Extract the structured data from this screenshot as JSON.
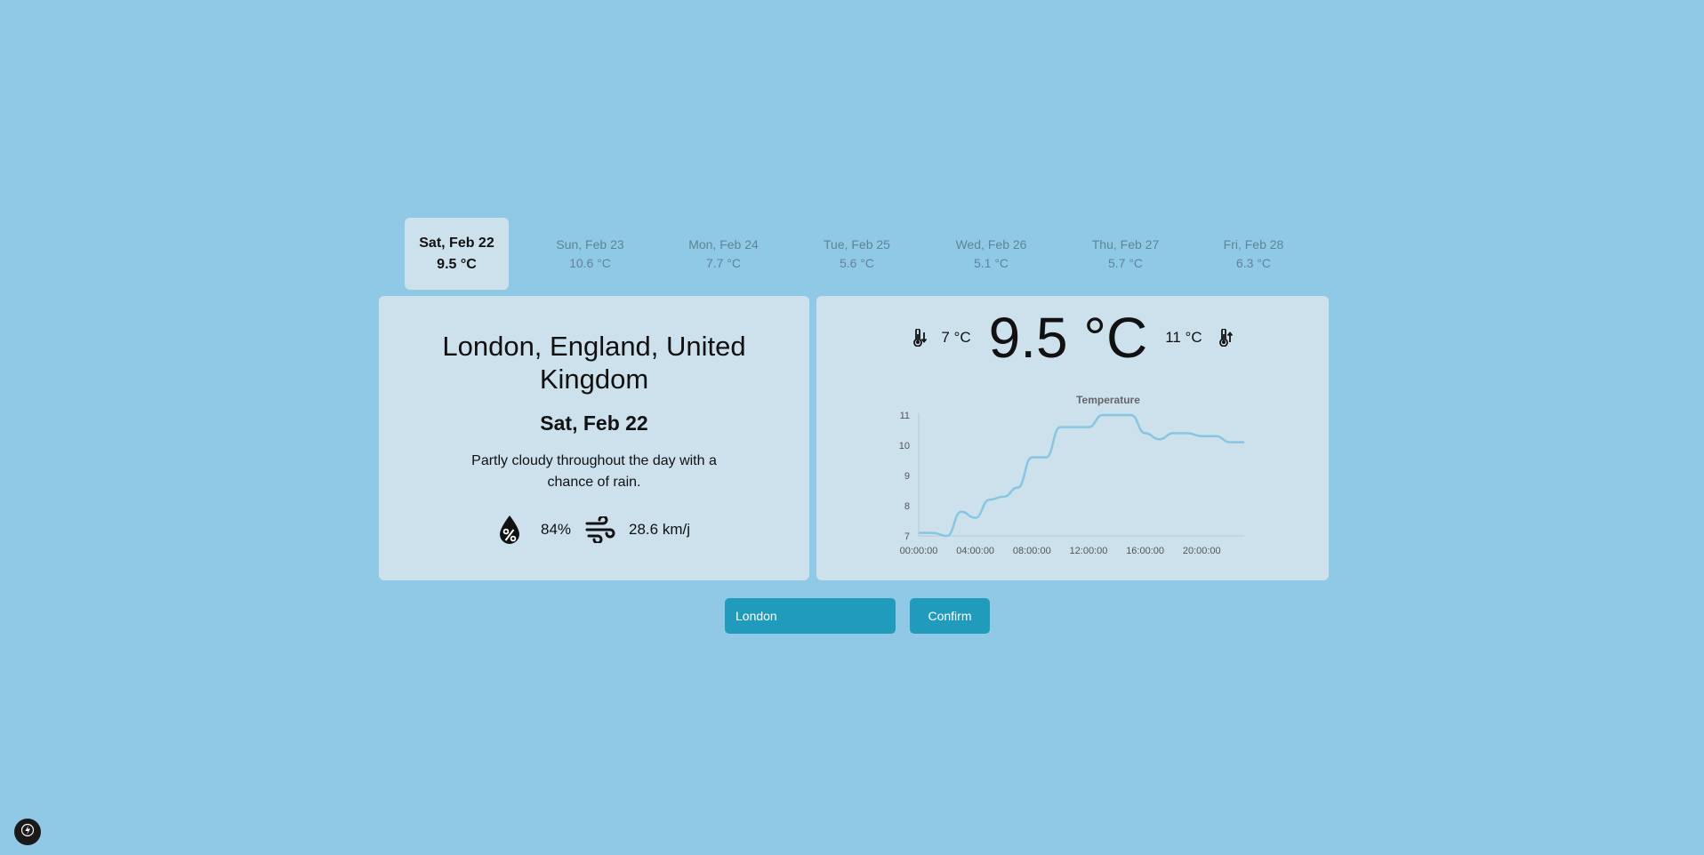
{
  "forecast": [
    {
      "date": "Sat, Feb 22",
      "temp": "9.5 °C"
    },
    {
      "date": "Sun, Feb 23",
      "temp": "10.6 °C"
    },
    {
      "date": "Mon, Feb 24",
      "temp": "7.7 °C"
    },
    {
      "date": "Tue, Feb 25",
      "temp": "5.6 °C"
    },
    {
      "date": "Wed, Feb 26",
      "temp": "5.1 °C"
    },
    {
      "date": "Thu, Feb 27",
      "temp": "5.7 °C"
    },
    {
      "date": "Fri, Feb 28",
      "temp": "6.3 °C"
    }
  ],
  "details": {
    "location": "London, England, United Kingdom",
    "date": "Sat, Feb 22",
    "description": "Partly cloudy throughout the day with a chance of rain.",
    "humidity": "84%",
    "wind": "28.6 km/j"
  },
  "current": {
    "min": "7 °C",
    "temp": "9.5 °C",
    "max": "11 °C"
  },
  "search": {
    "value": "London"
  },
  "confirm_label": "Confirm",
  "colors": {
    "background": "#90c9e6",
    "card": "#cde1ec",
    "accent": "#219bbc",
    "line": "#87c6e3"
  },
  "icons": {
    "humidity": "humidity-drop-icon",
    "wind": "wind-icon",
    "min": "thermometer-down-icon",
    "max": "thermometer-up-icon",
    "badge": "lightning-icon"
  },
  "chart_data": {
    "type": "line",
    "title": "Temperature",
    "xlabel": "",
    "ylabel": "",
    "x": [
      "00:00:00",
      "01:00:00",
      "02:00:00",
      "03:00:00",
      "04:00:00",
      "05:00:00",
      "06:00:00",
      "07:00:00",
      "08:00:00",
      "09:00:00",
      "10:00:00",
      "11:00:00",
      "12:00:00",
      "13:00:00",
      "14:00:00",
      "15:00:00",
      "16:00:00",
      "17:00:00",
      "18:00:00",
      "19:00:00",
      "20:00:00",
      "21:00:00",
      "22:00:00",
      "23:00:00"
    ],
    "xticks": [
      "00:00:00",
      "04:00:00",
      "08:00:00",
      "12:00:00",
      "16:00:00",
      "20:00:00"
    ],
    "yticks": [
      7,
      8,
      9,
      10,
      11
    ],
    "ylim": [
      7,
      11
    ],
    "series": [
      {
        "values": [
          7.1,
          7.1,
          7.0,
          7.8,
          7.6,
          8.2,
          8.3,
          8.6,
          9.6,
          9.6,
          10.6,
          10.6,
          10.6,
          11.0,
          11.0,
          11.0,
          10.4,
          10.2,
          10.4,
          10.4,
          10.3,
          10.3,
          10.1,
          10.1
        ]
      }
    ],
    "grid": false,
    "legend": "none"
  }
}
